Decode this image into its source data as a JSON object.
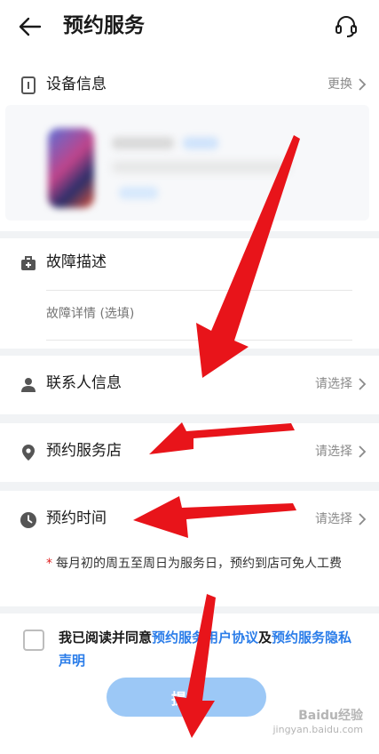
{
  "header": {
    "title": "预约服务",
    "back_icon": "arrow-left-icon",
    "support_icon": "headset-icon"
  },
  "device": {
    "title": "设备信息",
    "action": "更换"
  },
  "fault": {
    "title": "故障描述",
    "placeholder": "故障详情 (选填)"
  },
  "contact": {
    "title": "联系人信息",
    "action": "请选择"
  },
  "store": {
    "title": "预约服务店",
    "action": "请选择"
  },
  "time": {
    "title": "预约时间",
    "action": "请选择",
    "note_star": "*",
    "note": "每月初的周五至周日为服务日，预约到店可免人工费"
  },
  "agreement": {
    "prefix": "我已阅读并同意",
    "link1": "预约服务用户协议",
    "middle": "及",
    "link2": "预约服务隐私声明"
  },
  "submit": {
    "label": "提交"
  },
  "watermark": {
    "line1": "Baidu经验",
    "line2": "jingyan.baidu.com"
  },
  "colors": {
    "accent": "#2b7de9",
    "submit_bg": "#9cc8f6",
    "annotation_red": "#e8141a"
  }
}
